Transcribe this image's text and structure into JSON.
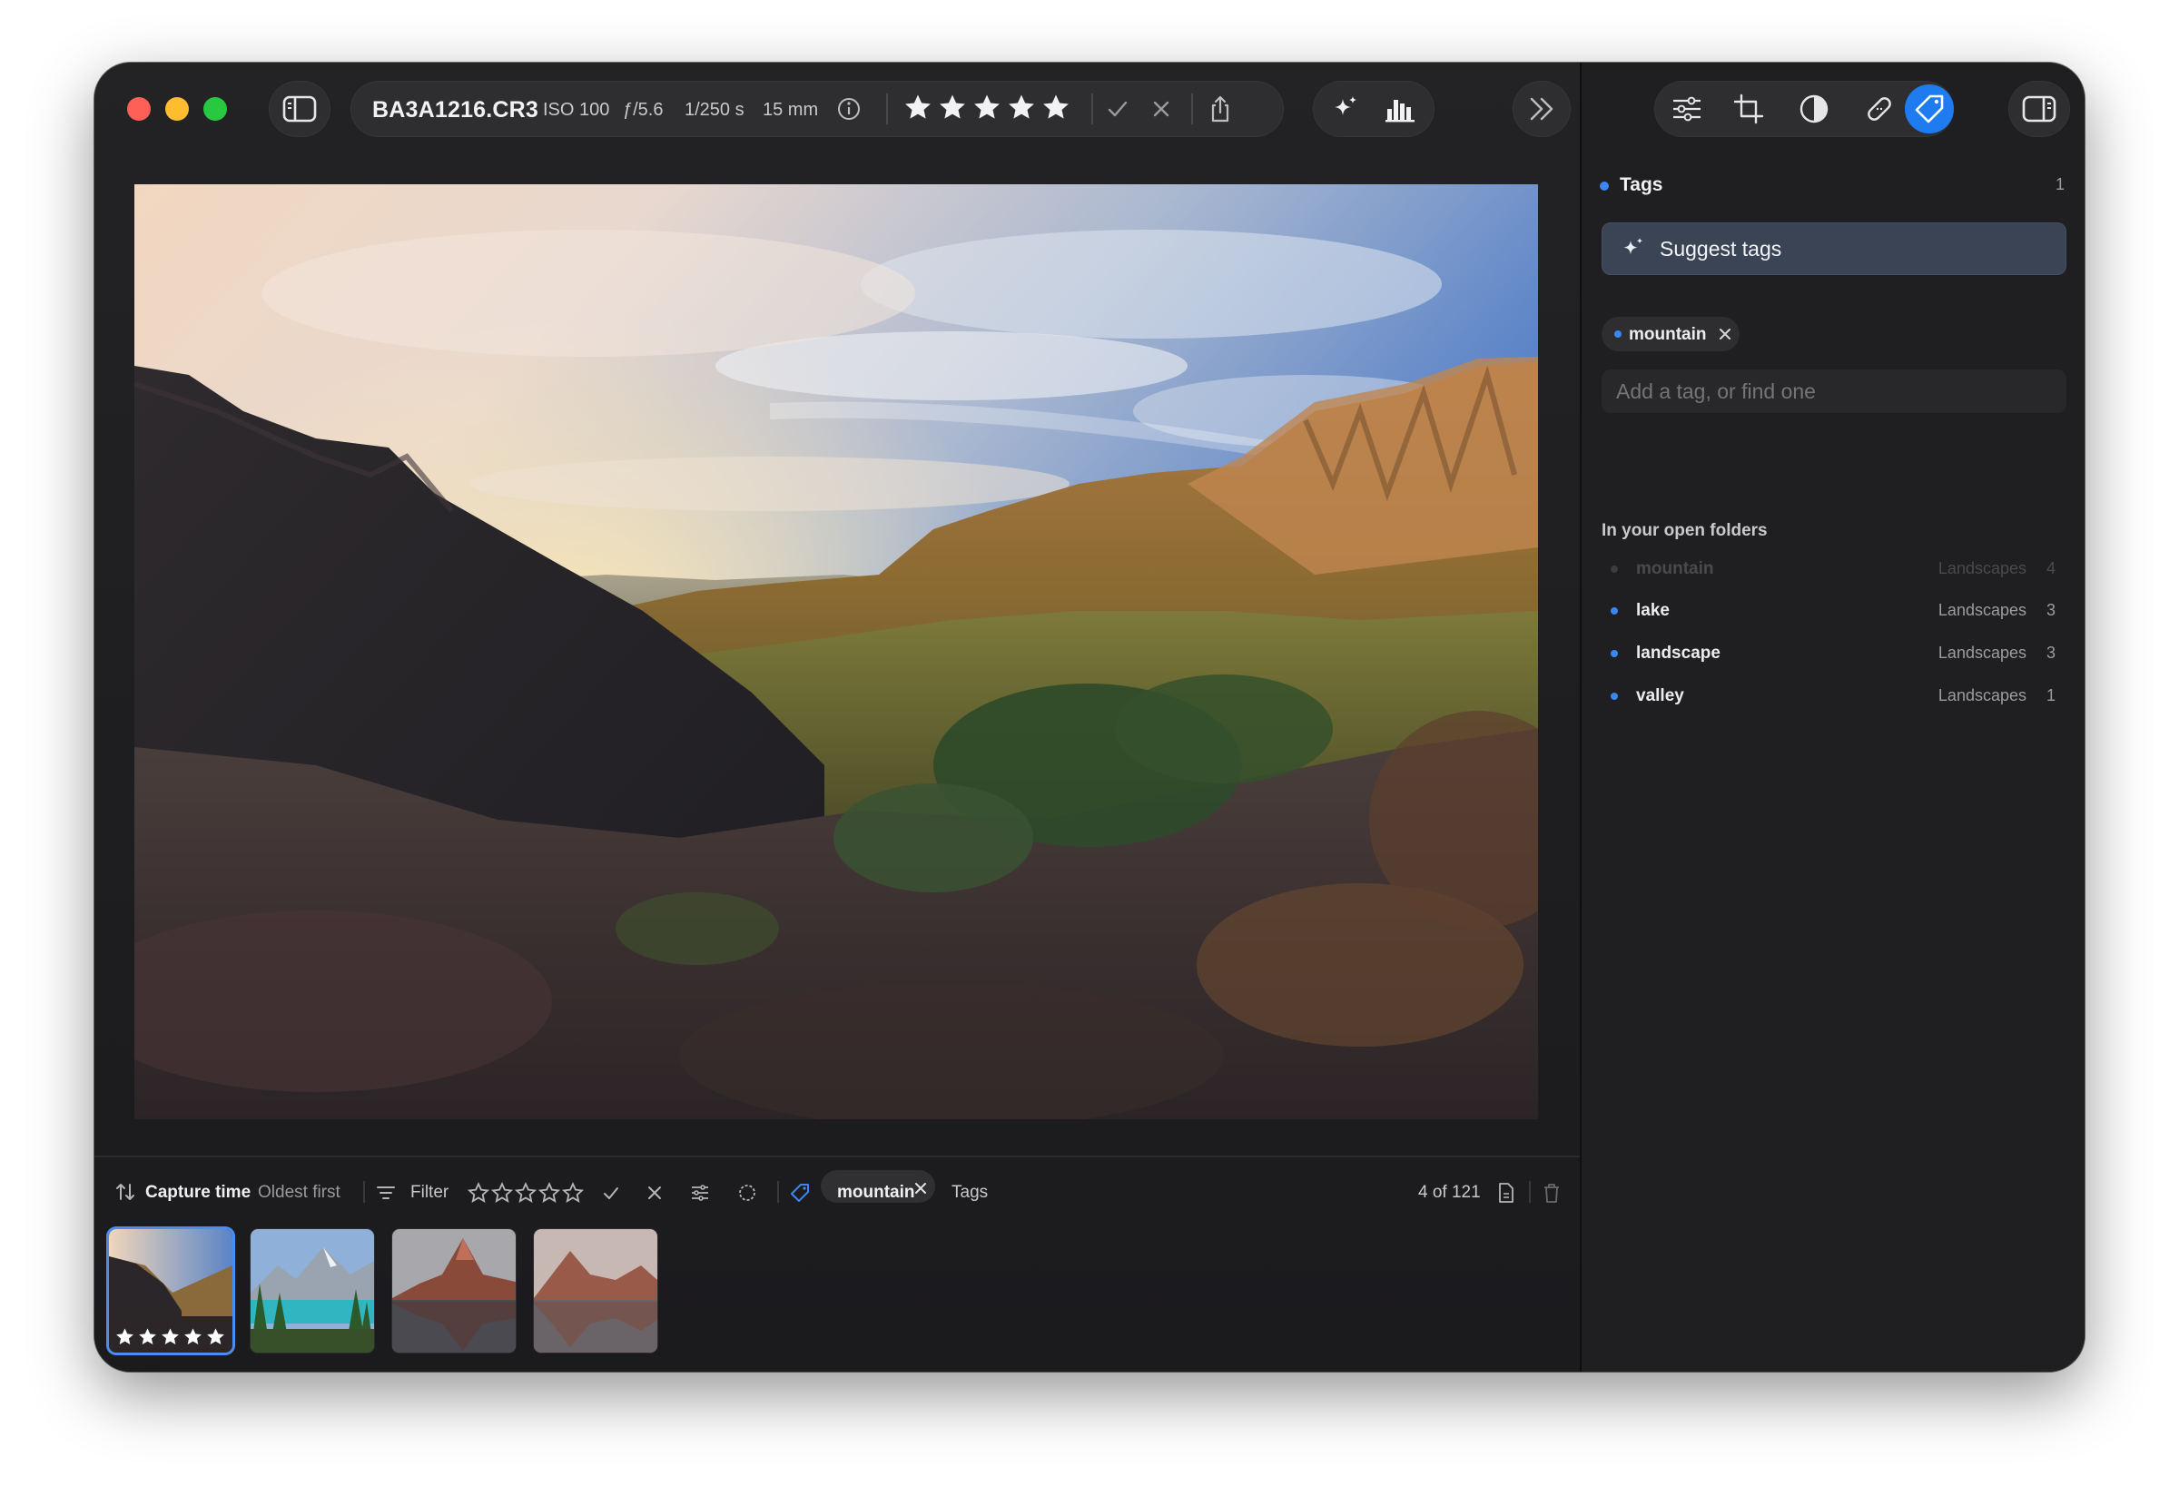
{
  "toolbar": {
    "filename": "BA3A1216.CR3",
    "iso": "ISO 100",
    "aperture": "ƒ/5.6",
    "shutter": "1/250 s",
    "focal": "15 mm",
    "rating": 5
  },
  "image": {
    "description": "Desert mountain valley at sunset under a cloudy sky"
  },
  "bottombar": {
    "sort_label": "Capture time",
    "sort_order": "Oldest first",
    "filter_label": "Filter",
    "tag_chip": "mountain",
    "tags_label": "Tags",
    "position": "4 of 121"
  },
  "thumbnails": [
    {
      "name": "valley",
      "selected": true,
      "rating": 5
    },
    {
      "name": "lake-forest",
      "selected": false
    },
    {
      "name": "red-peak-lake",
      "selected": false
    },
    {
      "name": "red-peak-lake-2",
      "selected": false
    }
  ],
  "sidebar": {
    "section_title": "Tags",
    "section_count": "1",
    "suggest_label": "Suggest tags",
    "current_tag": "mountain",
    "input_placeholder": "Add a tag, or find one",
    "folders_header": "In your open folders",
    "rows": [
      {
        "name": "mountain",
        "folder": "Landscapes",
        "count": "4"
      },
      {
        "name": "lake",
        "folder": "Landscapes",
        "count": "3"
      },
      {
        "name": "landscape",
        "folder": "Landscapes",
        "count": "3"
      },
      {
        "name": "valley",
        "folder": "Landscapes",
        "count": "1"
      }
    ]
  },
  "colors": {
    "accent": "#3a86f5",
    "window_bg": "#18181b",
    "sidebar_bg": "#1f1f21"
  }
}
